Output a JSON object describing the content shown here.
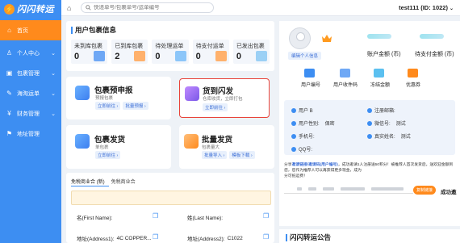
{
  "brand": {
    "logo_text": "闪闪转运"
  },
  "sidebar": {
    "items": [
      {
        "label": "首页",
        "icon": "home-icon",
        "glyph": "⌂",
        "active": true,
        "chevron": ""
      },
      {
        "label": "个人中心",
        "icon": "user-icon",
        "glyph": "♙",
        "active": false,
        "chevron": "⌄"
      },
      {
        "label": "包裹管理",
        "icon": "package-icon",
        "glyph": "▣",
        "active": false,
        "chevron": "⌄"
      },
      {
        "label": "海淘运单",
        "icon": "waybill-icon",
        "glyph": "✎",
        "active": false,
        "chevron": "⌄"
      },
      {
        "label": "财务管理",
        "icon": "finance-icon",
        "glyph": "¥",
        "active": false,
        "chevron": "⌄"
      },
      {
        "label": "地址管理",
        "icon": "address-icon",
        "glyph": "⚑",
        "active": false,
        "chevron": ""
      }
    ]
  },
  "topbar": {
    "search_placeholder": "快递单号/包裹单号/运单编号",
    "user": "test111 (ID: 1022)",
    "caret": "⌄"
  },
  "package_info": {
    "title": "用户包裹信息",
    "cards": [
      {
        "label": "未到库包裹",
        "value": "0",
        "color": "#6fa8f5"
      },
      {
        "label": "已到库包裹",
        "value": "2",
        "color": "#ffb16c"
      },
      {
        "label": "待处理运单",
        "value": "0",
        "color": "#8cc6f9"
      },
      {
        "label": "待支付运单",
        "value": "0",
        "color": "#ffb16c"
      },
      {
        "label": "已发出包裹",
        "value": "0",
        "color": "#9bd0f5"
      }
    ]
  },
  "actions": {
    "prebook": {
      "title": "包裹预申报",
      "sub": "预报包裹",
      "buttons": [
        "立即前往 ›",
        "批量预报 ›"
      ]
    },
    "flash": {
      "title": "货到闪发",
      "sub": "仓库收货，立即打包",
      "buttons": [
        "立即前往 ›"
      ]
    },
    "ship": {
      "title": "包裹发货",
      "sub": "单包裹",
      "buttons": [
        "立即前往 ›"
      ]
    },
    "batch": {
      "title": "批量发货",
      "sub": "包裹量大",
      "buttons": [
        "批量导入 ›",
        "模板下载 ›"
      ]
    }
  },
  "address": {
    "tabs": [
      "免税商业合 (新)",
      "免税商业合"
    ],
    "fields": [
      {
        "label": "名(First Name):",
        "value": ""
      },
      {
        "label": "姓(Last Name):",
        "value": ""
      },
      {
        "label": "地址(Address1):",
        "value": "4C COPPER..."
      },
      {
        "label": "地址(Address2):",
        "value": "C1022"
      }
    ]
  },
  "account": {
    "edit_button": "编辑个人信息",
    "balance_label": "账户金额 (币)",
    "pending_label": "待支付金额 (币)",
    "stats": [
      "用户编号",
      "用户收件码",
      "冻结金额",
      "优惠券"
    ],
    "info": {
      "user": "用户 B",
      "register_date": "注册邮箱:",
      "gender_label": "用户性别:",
      "gender_value": "保密",
      "wechat_label": "微信号:",
      "wechat_value": "测试",
      "phone": "手机号:",
      "realname_label": "真实姓名:",
      "realname_value": "测试",
      "qq": "QQ号:"
    }
  },
  "share": {
    "text_prefix": "分享",
    "link_text": "邀请链接/邀请码(用户编号)",
    "text_suffix": "，成功邀请1人注册送50积分！被推荐人首次发货后，送欢迎金额到您，您作为推荐人可以再获得更多现金，成为",
    "text_line2": "分可抵运费！",
    "copy_button": "复制链接",
    "ok_text": "成功邀"
  },
  "notice": {
    "title": "闪闪转运公告"
  },
  "colors": {
    "primary": "#3d8ef2",
    "accent": "#ff8a1c",
    "highlight_border": "#e8433a"
  }
}
